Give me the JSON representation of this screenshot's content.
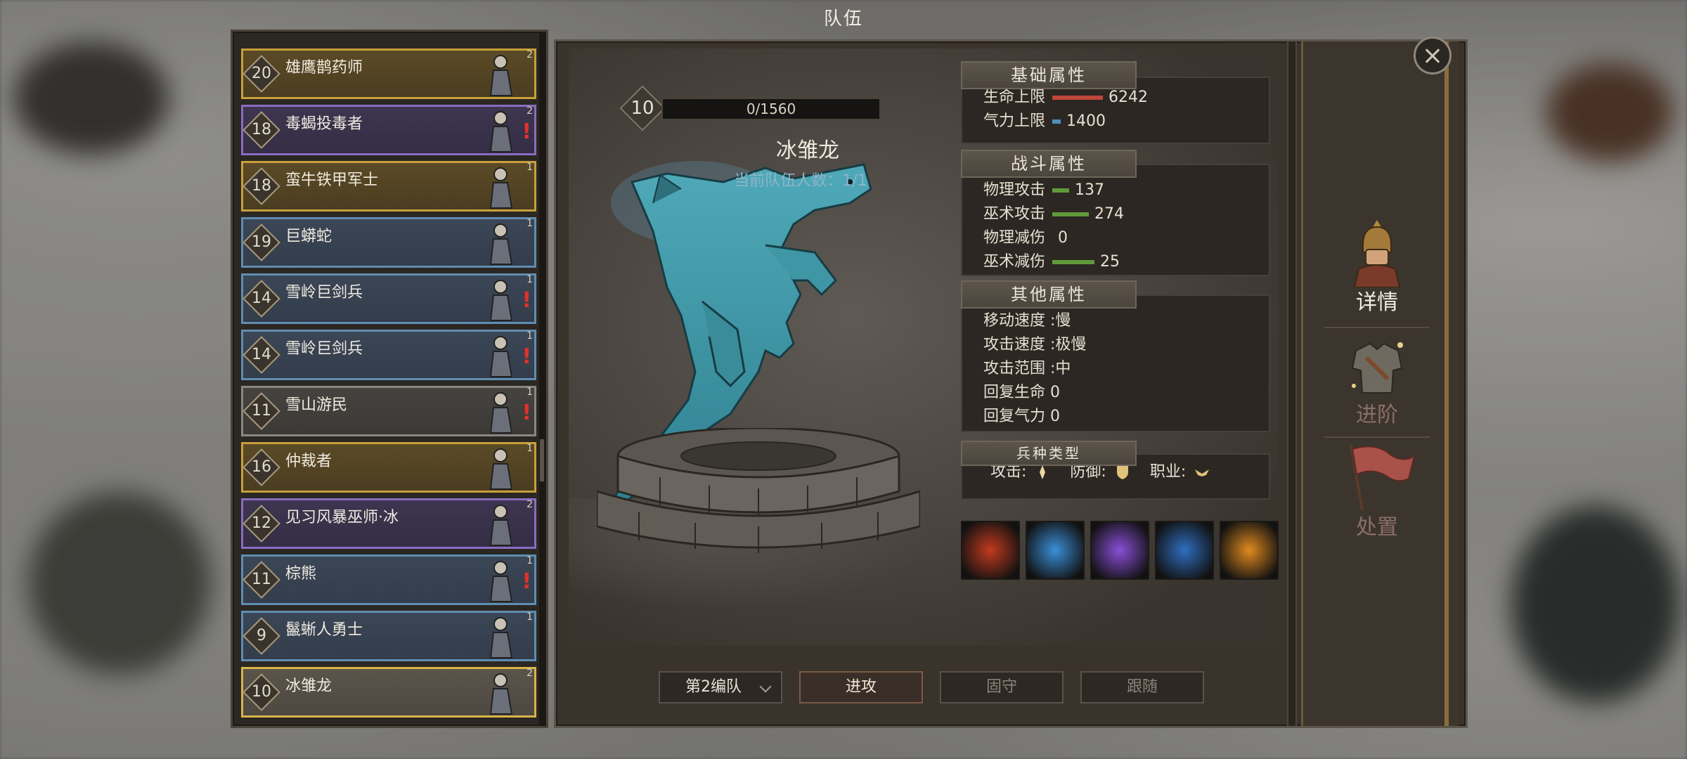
{
  "window_title": "队伍",
  "roster": [
    {
      "level": "20",
      "name": "雄鹰鹊药师",
      "count": "2",
      "style": "gold",
      "alert": false
    },
    {
      "level": "18",
      "name": "毒蝎投毒者",
      "count": "2",
      "style": "purple",
      "alert": true
    },
    {
      "level": "18",
      "name": "蛮牛铁甲军士",
      "count": "1",
      "style": "gold",
      "alert": false
    },
    {
      "level": "19",
      "name": "巨蟒蛇",
      "count": "1",
      "style": "blue",
      "alert": false
    },
    {
      "level": "14",
      "name": "雪岭巨剑兵",
      "count": "1",
      "style": "blue",
      "alert": true
    },
    {
      "level": "14",
      "name": "雪岭巨剑兵",
      "count": "1",
      "style": "blue",
      "alert": true
    },
    {
      "level": "11",
      "name": "雪山游民",
      "count": "1",
      "style": "grey",
      "alert": true
    },
    {
      "level": "16",
      "name": "仲裁者",
      "count": "1",
      "style": "gold",
      "alert": false
    },
    {
      "level": "12",
      "name": "见习风暴巫师·冰",
      "count": "2",
      "style": "purple",
      "alert": false
    },
    {
      "level": "11",
      "name": "棕熊",
      "count": "1",
      "style": "blue",
      "alert": true
    },
    {
      "level": "9",
      "name": "鬣蜥人勇士",
      "count": "1",
      "style": "blue",
      "alert": false
    },
    {
      "level": "10",
      "name": "冰雏龙",
      "count": "2",
      "style": "selected",
      "alert": false
    }
  ],
  "unit": {
    "level": "10",
    "xp": "0/1560",
    "name": "冰雏龙",
    "team_count": "当前队伍人数：1/1"
  },
  "basic": {
    "title": "基础属性",
    "rows": [
      {
        "label": "生命上限",
        "value": "6242",
        "bar_color": "#c0463a",
        "bar_fraction": 0.9
      },
      {
        "label": "气力上限",
        "value": "1400",
        "bar_color": "#4f8fbf",
        "bar_fraction": 0.15
      }
    ]
  },
  "combat": {
    "title": "战斗属性",
    "rows": [
      {
        "label": "物理攻击",
        "value": "137",
        "bar_color": "#5f9a3a",
        "bar_fraction": 0.3
      },
      {
        "label": "巫术攻击",
        "value": "274",
        "bar_color": "#5f9a3a",
        "bar_fraction": 0.65
      },
      {
        "label": "物理减伤",
        "value": "0",
        "bar_color": "#5f9a3a",
        "bar_fraction": 0
      },
      {
        "label": "巫术减伤",
        "value": "25",
        "bar_color": "#5f9a3a",
        "bar_fraction": 0.75
      }
    ]
  },
  "other": {
    "title": "其他属性",
    "rows": [
      {
        "text": "移动速度 :慢"
      },
      {
        "text": "攻击速度 :极慢"
      },
      {
        "text": "攻击范围 :中"
      },
      {
        "text": "回复生命  0"
      },
      {
        "text": "回复气力  0"
      }
    ]
  },
  "troop_type": {
    "title": "兵种类型",
    "attack": "攻击:",
    "defense": "防御:",
    "role": "职业:"
  },
  "skills": [
    {
      "icon": "fire-dragon-icon",
      "color": "#c23a1e"
    },
    {
      "icon": "ice-breath-icon",
      "color": "#3a8fd8"
    },
    {
      "icon": "arcane-figures-icon",
      "color": "#8a4fd8"
    },
    {
      "icon": "frost-vortex-icon",
      "color": "#2f6fc0"
    },
    {
      "icon": "flame-burst-icon",
      "color": "#e08a1f"
    }
  ],
  "controls": {
    "team_select": "第2编队",
    "attack": "进攻",
    "hold": "固守",
    "follow": "跟随"
  },
  "side_tabs": [
    {
      "label": "详情",
      "icon": "helmet-warrior-icon",
      "active": true
    },
    {
      "label": "进阶",
      "icon": "armor-icon",
      "active": false
    },
    {
      "label": "处置",
      "icon": "flag-icon",
      "active": false
    }
  ]
}
